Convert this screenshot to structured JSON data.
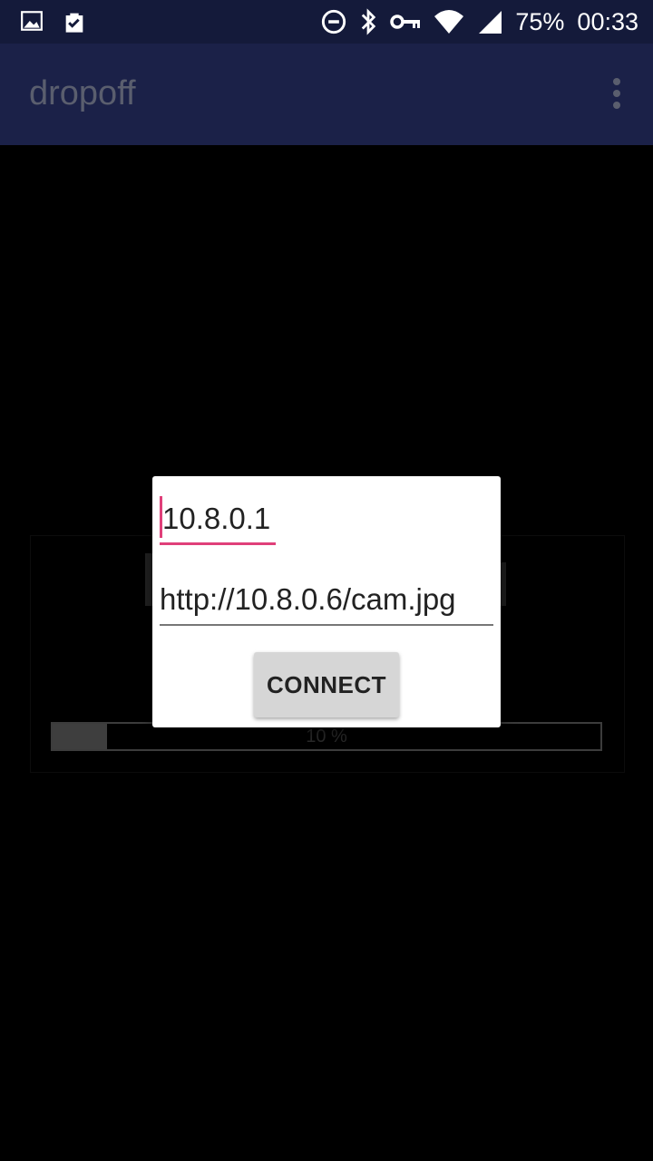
{
  "status_bar": {
    "battery": "75%",
    "time": "00:33",
    "icons": [
      "image-icon",
      "clipboard-check-icon",
      "do-not-disturb-icon",
      "bluetooth-icon",
      "vpn-key-icon",
      "wifi-icon",
      "signal-icon"
    ]
  },
  "app_bar": {
    "title": "dropoff",
    "menu_icon": "overflow-menu-icon"
  },
  "dialog": {
    "host_value": "10.8.0.1",
    "url_value": "http://10.8.0.6/cam.jpg",
    "connect_label": "CONNECT"
  },
  "background": {
    "progress_label": "10 %",
    "progress_fraction": 0.1
  },
  "colors": {
    "status_bar": "#141a3a",
    "app_bar": "#1b2148",
    "accent": "#e0407a"
  }
}
